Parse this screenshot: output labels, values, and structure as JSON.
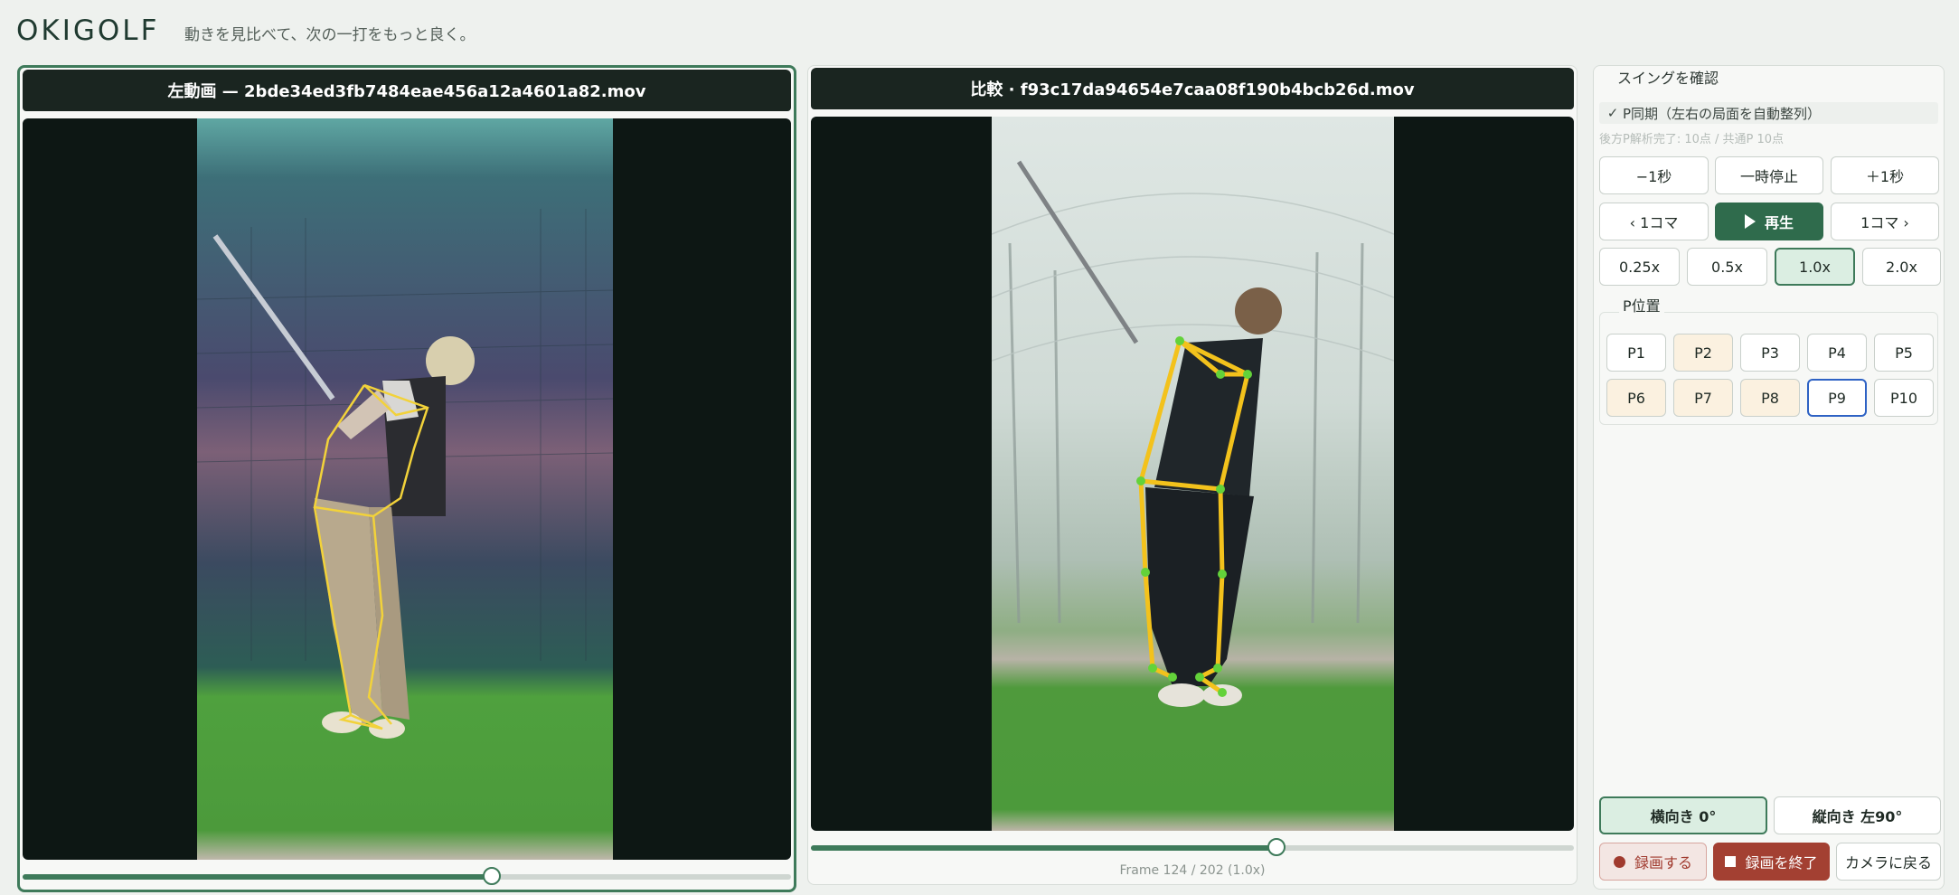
{
  "header": {
    "logo": "OKIGOLF",
    "tagline": "動きを見比べて、次の一打をもっと良く。"
  },
  "left_video": {
    "title": "左動画 — 2bde34ed3fb7484eae456a12a4601a82.mov",
    "progress": 0.61
  },
  "right_video": {
    "title": "比較 · f93c17da94654e7caa08f190b4bcb26d.mov",
    "progress": 0.61,
    "frame_label": "Frame 124 / 202 (1.0x)"
  },
  "sidebar": {
    "section_title": "スイングを確認",
    "sync_label": "P同期（左右の局面を自動整列）",
    "sync_checked": true,
    "status_note": "後方P解析完了: 10点 / 共通P 10点",
    "seek_buttons": [
      "−1秒",
      "一時停止",
      "＋1秒"
    ],
    "frame_prev": "‹ 1コマ",
    "play_label": "再生",
    "frame_next": "1コマ ›",
    "speeds": [
      "0.25x",
      "0.5x",
      "1.0x",
      "2.0x"
    ],
    "active_speed": "1.0x",
    "p_title": "P位置",
    "positions": [
      "P1",
      "P2",
      "P3",
      "P4",
      "P5",
      "P6",
      "P7",
      "P8",
      "P9",
      "P10"
    ],
    "highlighted_positions": [
      "P2",
      "P6",
      "P7",
      "P8"
    ],
    "selected_position": "P9",
    "orientation": {
      "landscape": "横向き 0°",
      "portrait": "縦向き 左90°",
      "active": "landscape"
    },
    "record_label": "録画する",
    "stop_record_label": "録画を終了",
    "camera_back_label": "カメラに戻る"
  },
  "colors": {
    "accent": "#3e7a5a",
    "play": "#2f6b4c",
    "record": "#a03a2e",
    "skeleton_left": "#f2d23a",
    "skeleton_right": "#f3c21c",
    "joint": "#63d23a"
  }
}
